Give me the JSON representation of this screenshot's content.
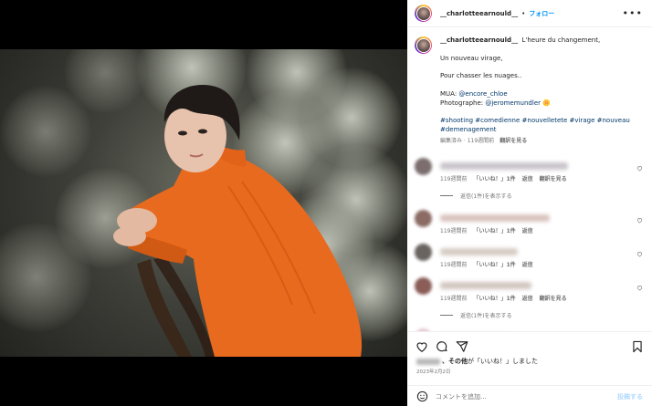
{
  "post": {
    "username": "__charlotteearnould__",
    "separator": "•",
    "follow_label": "フォロー",
    "more_label": "•••"
  },
  "caption": {
    "username": "__charlotteearnould__",
    "line1": "L'heure du changement,",
    "line2": "Un nouveau virage,",
    "line3": "Pour chasser les nuages..",
    "mua_label": "MUA: ",
    "mua_handle": "@encore_chloe",
    "photo_label": "Photographe: ",
    "photo_handle": "@jeromemundler",
    "emoji": "🌼",
    "hashtags": "#shooting #comedienne #nouvelletete #virage #nouveau #demenagement",
    "meta_edited": "編集済み · 119週間前",
    "meta_translate": "翻訳を見る"
  },
  "comments": [
    {
      "time": "119週間前",
      "likes": "「いいね！」1件",
      "reply": "返信",
      "translate": "翻訳を見る",
      "replies": "返信(1件)を表示する",
      "name_color": "#c9c3cb",
      "avatar_color": "#7c6e6e"
    },
    {
      "time": "119週間前",
      "likes": "「いいね！」1件",
      "reply": "返信",
      "translate": "",
      "replies": "",
      "name_color": "#d9c3bf",
      "avatar_color": "#8b6b63"
    },
    {
      "time": "119週間前",
      "likes": "「いいね！」1件",
      "reply": "返信",
      "translate": "",
      "replies": "",
      "name_color": "#d6ccc4",
      "avatar_color": "#6a6460"
    },
    {
      "time": "119週間前",
      "likes": "「いいね！」1件",
      "reply": "返信",
      "translate": "翻訳を見る",
      "replies": "返信(1件)を表示する",
      "name_color": "#d2c7c0",
      "avatar_color": "#8a5d57"
    }
  ],
  "likes": {
    "suffix": "、その他",
    "suffix2": "が「いいね！」しました"
  },
  "date": "2023年2月2日",
  "add_comment": {
    "placeholder": "コメントを追加...",
    "post_label": "投稿する"
  },
  "icons": [
    "heart-icon",
    "comment-icon",
    "share-icon",
    "bookmark-icon",
    "emoji-icon"
  ],
  "colors": {
    "accent": "#0095f6",
    "link": "#00376b",
    "muted": "#737373",
    "sweater": "#e86a1e"
  }
}
